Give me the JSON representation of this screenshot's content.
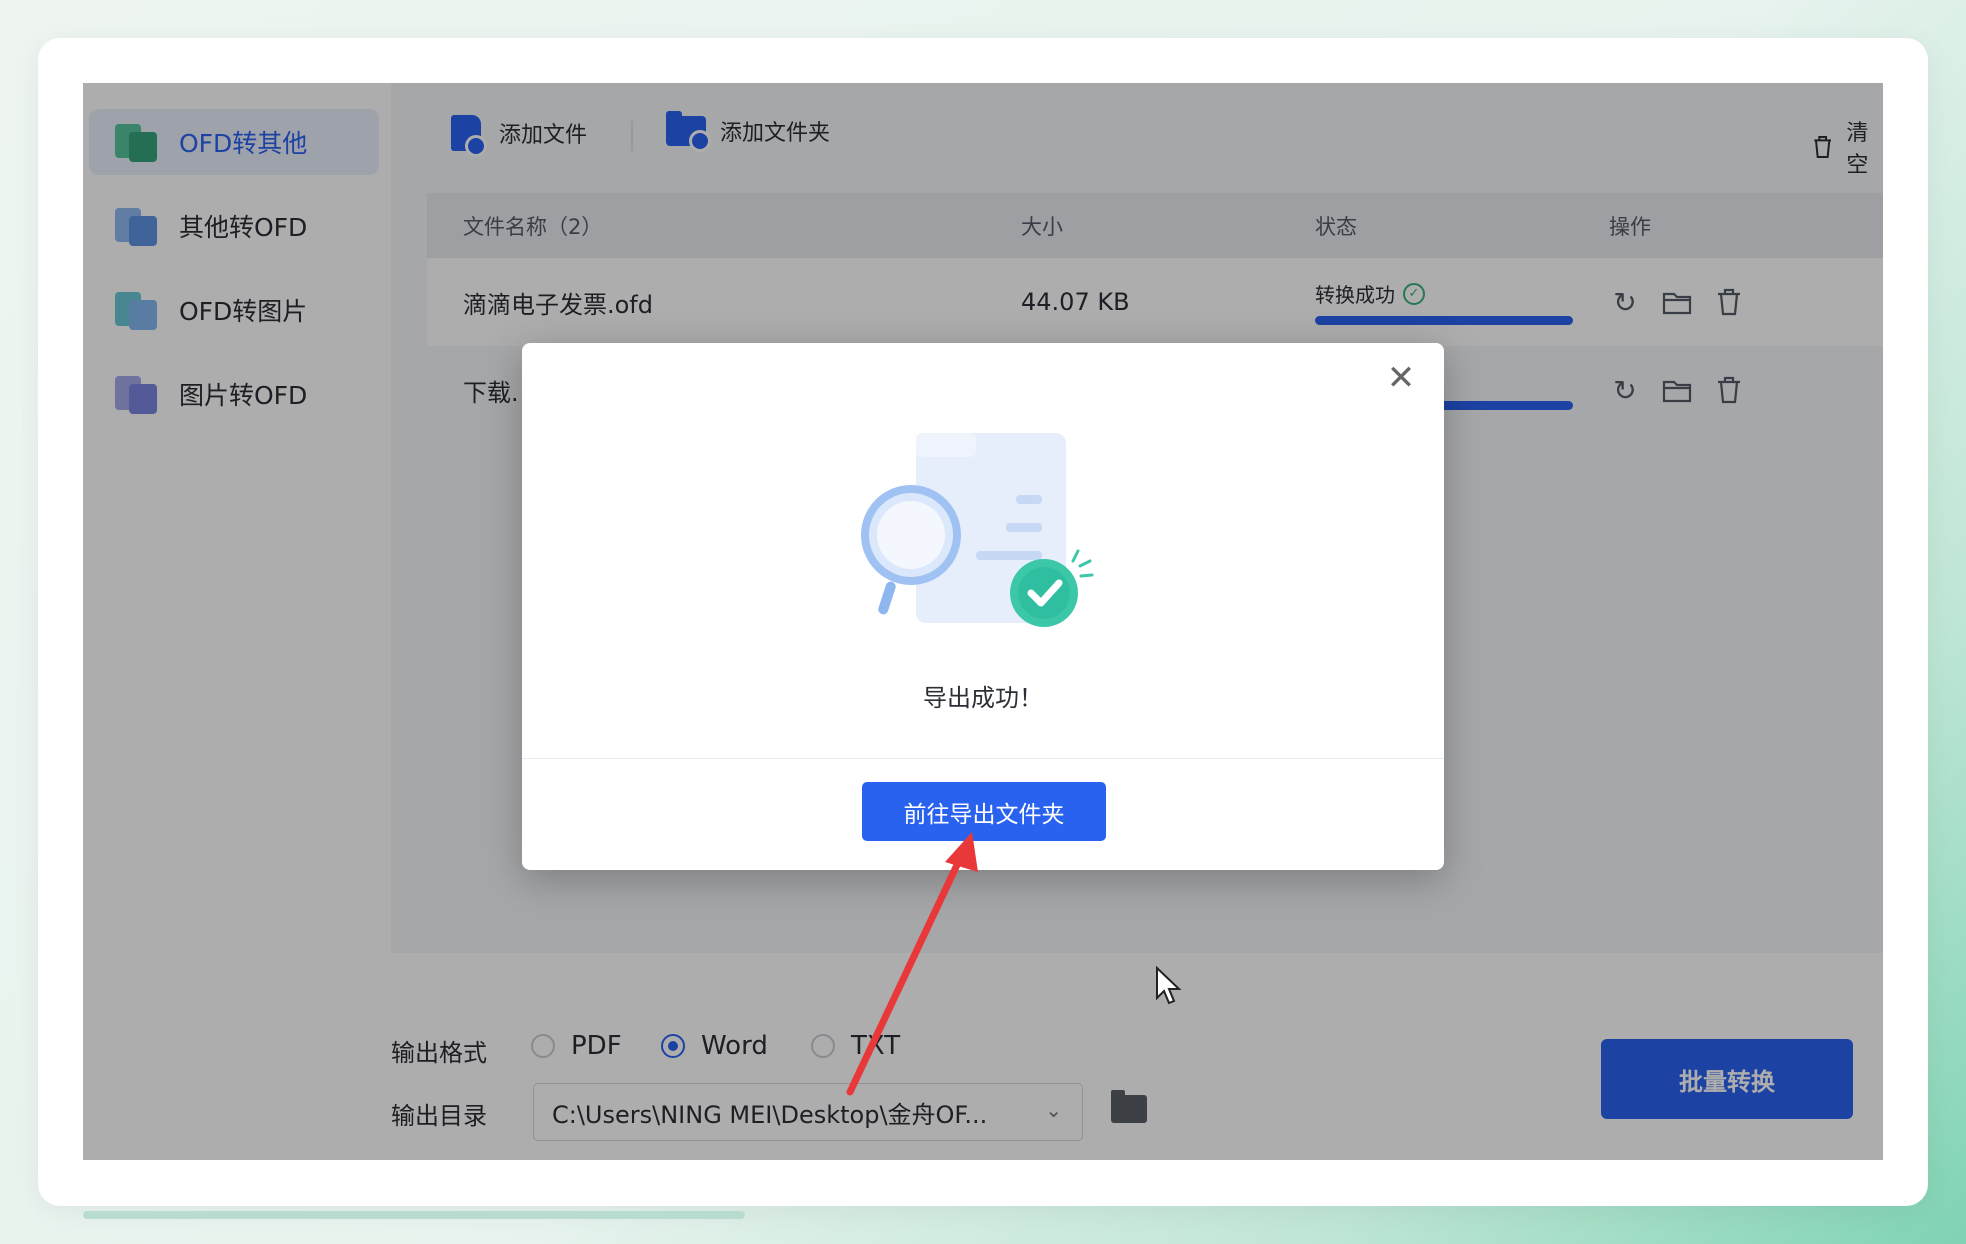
{
  "sidebar": {
    "items": [
      {
        "label": "OFD转其他"
      },
      {
        "label": "其他转OFD"
      },
      {
        "label": "OFD转图片"
      },
      {
        "label": "图片转OFD"
      }
    ]
  },
  "toolbar": {
    "add_file": "添加文件",
    "add_folder": "添加文件夹",
    "clear": "清空"
  },
  "table": {
    "headers": {
      "name": "文件名称（2）",
      "size": "大小",
      "status": "状态",
      "ops": "操作"
    },
    "rows": [
      {
        "name": "滴滴电子发票.ofd",
        "size": "44.07 KB",
        "status": "转换成功",
        "progress": 1.0
      },
      {
        "name": "下载.",
        "size": "",
        "status": "",
        "progress": 1.0
      }
    ]
  },
  "output": {
    "format_label": "输出格式",
    "formats": [
      "PDF",
      "Word",
      "TXT"
    ],
    "selected_format": "Word",
    "dir_label": "输出目录",
    "dir_value": "C:\\Users\\NING MEI\\Desktop\\金舟OF...",
    "batch_button": "批量转换"
  },
  "dialog": {
    "message": "导出成功！",
    "button": "前往导出文件夹"
  },
  "colors": {
    "accent": "#2a62f0",
    "success": "#38b27c",
    "annotation_arrow": "#e8383a"
  }
}
